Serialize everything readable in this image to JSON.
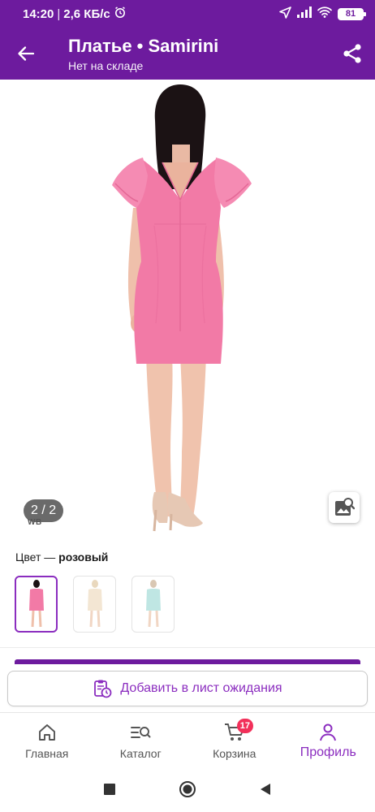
{
  "status_bar": {
    "time": "14:20",
    "network_speed": "2,6 КБ/с",
    "battery": "81",
    "icons": [
      "alarm-icon",
      "location-arrow-icon",
      "signal-icon",
      "wifi-icon",
      "battery-icon"
    ]
  },
  "app_bar": {
    "title": "Платье • Samirini",
    "subtitle": "Нет на складе",
    "back_icon": "arrow-back-icon",
    "share_icon": "share-icon"
  },
  "gallery": {
    "page_indicator": "2 / 2",
    "watermark": "WB",
    "similar_icon": "image-search-icon"
  },
  "color_section": {
    "label": "Цвет — ",
    "value": "розовый",
    "swatches": [
      {
        "name": "pink",
        "color": "#f27aa6",
        "selected": true
      },
      {
        "name": "beige",
        "color": "#f3e6d3",
        "selected": false
      },
      {
        "name": "mint",
        "color": "#bfe6e3",
        "selected": false
      }
    ]
  },
  "waitlist": {
    "label": "Добавить в лист ожидания",
    "icon": "clipboard-clock-icon"
  },
  "bottom_nav": {
    "items": [
      {
        "label": "Главная",
        "icon": "home-icon",
        "active": false
      },
      {
        "label": "Каталог",
        "icon": "catalog-search-icon",
        "active": false
      },
      {
        "label": "Корзина",
        "icon": "cart-icon",
        "active": false,
        "badge": "17"
      },
      {
        "label": "Профиль",
        "icon": "profile-icon",
        "active": true
      }
    ]
  },
  "system_nav": {
    "icons": [
      "recent-apps-icon",
      "home-circle-icon",
      "back-triangle-icon"
    ]
  },
  "colors": {
    "brand": "#6d1b9e",
    "accent": "#8b2dbf",
    "badge": "#f2305a",
    "dress": "#f27aa6"
  }
}
